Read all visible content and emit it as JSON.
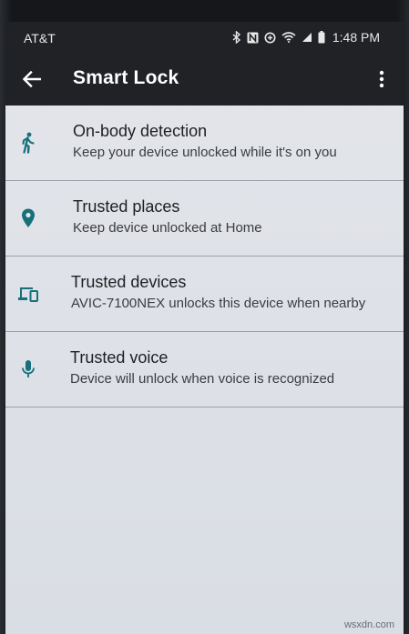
{
  "statusbar": {
    "carrier": "AT&T",
    "time": "1:48 PM"
  },
  "appbar": {
    "title": "Smart Lock"
  },
  "items": [
    {
      "title": "On-body detection",
      "subtitle": "Keep your device unlocked while it's on you",
      "icon": "walking-person-icon"
    },
    {
      "title": "Trusted places",
      "subtitle": "Keep device unlocked at Home",
      "icon": "location-pin-icon"
    },
    {
      "title": "Trusted devices",
      "subtitle": "AVIC-7100NEX unlocks this device when nearby",
      "icon": "devices-icon"
    },
    {
      "title": "Trusted voice",
      "subtitle": "Device will unlock when voice is recognized",
      "icon": "microphone-icon"
    }
  ],
  "watermark": "wsxdn.com",
  "colors": {
    "icon_teal": "#17707a",
    "appbar_bg": "#202225",
    "list_bg": "#e2e5ea",
    "divider": "#9aa0a8"
  }
}
